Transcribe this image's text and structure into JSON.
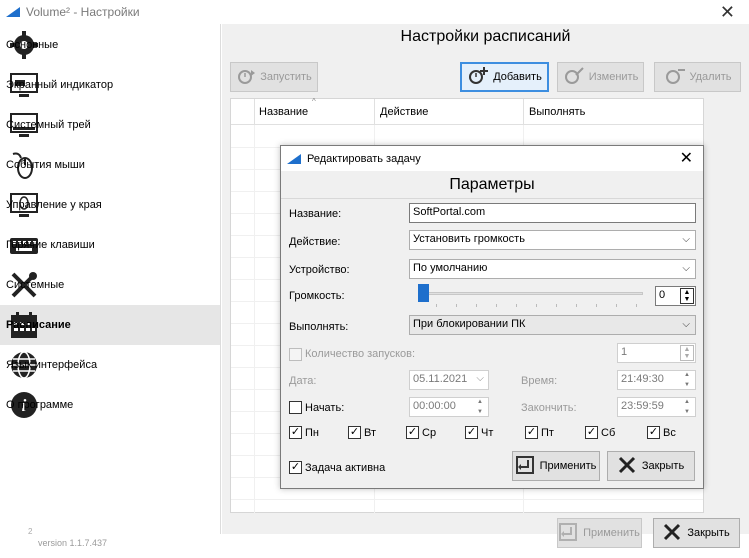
{
  "window": {
    "title": "Volume² - Настройки"
  },
  "sidebar": {
    "items": [
      {
        "label": "Основные",
        "icon": "gear-icon"
      },
      {
        "label": "Экранный индикатор",
        "icon": "monitor-icon"
      },
      {
        "label": "Системный трей",
        "icon": "tray-icon"
      },
      {
        "label": "События мыши",
        "icon": "mouse-icon"
      },
      {
        "label": "Управление у края",
        "icon": "edge-icon"
      },
      {
        "label": "Горячие клавиши",
        "icon": "keyboard-icon"
      },
      {
        "label": "Системные",
        "icon": "tools-icon"
      },
      {
        "label": "Расписание",
        "icon": "calendar-icon",
        "active": true
      },
      {
        "label": "Язык интерфейса",
        "icon": "globe-icon"
      },
      {
        "label": "О программе",
        "icon": "info-icon"
      }
    ],
    "version_sup": "2",
    "version": "version 1.1.7.437"
  },
  "main": {
    "title": "Настройки расписаний",
    "toolbar": {
      "run": "Запустить",
      "add": "Добавить",
      "edit": "Изменить",
      "delete": "Удалить"
    },
    "grid": {
      "columns": [
        "Название",
        "Действие",
        "Выполнять"
      ]
    },
    "apply": "Применить",
    "close": "Закрыть"
  },
  "dialog": {
    "title": "Редактировать задачу",
    "heading": "Параметры",
    "name_label": "Название:",
    "name_value": "SoftPortal.com",
    "action_label": "Действие:",
    "action_value": "Установить громкость",
    "device_label": "Устройство:",
    "device_value": "По умолчанию",
    "volume_label": "Громкость:",
    "volume_value": "0",
    "run_label": "Выполнять:",
    "run_value": "При блокировании ПК",
    "count_label": "Количество запусков:",
    "count_value": "1",
    "date_label": "Дата:",
    "date_value": "05.11.2021",
    "time_label": "Время:",
    "time_value": "21:49:30",
    "start_label": "Начать:",
    "start_value": "00:00:00",
    "end_label": "Закончить:",
    "end_value": "23:59:59",
    "days": [
      "Пн",
      "Вт",
      "Ср",
      "Чт",
      "Пт",
      "Сб",
      "Вс"
    ],
    "active_label": "Задача активна",
    "apply": "Применить",
    "close": "Закрыть"
  },
  "colors": {
    "accent": "#1e6fcc",
    "selected_row": "#e6e6e6"
  }
}
